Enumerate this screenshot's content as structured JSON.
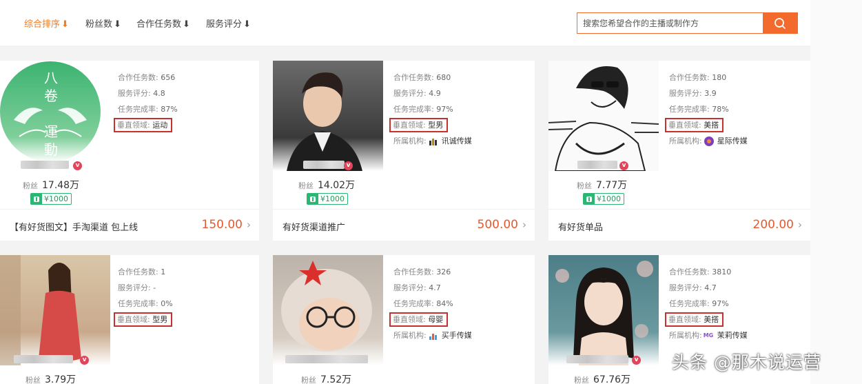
{
  "sort_bar": {
    "items": [
      {
        "label": "综合排序",
        "active": true
      },
      {
        "label": "粉丝数",
        "active": false
      },
      {
        "label": "合作任务数",
        "active": false
      },
      {
        "label": "服务评分",
        "active": false
      }
    ],
    "arrow": "⬇"
  },
  "search": {
    "placeholder": "搜索您希望合作的主播或制作方",
    "icon": "search-icon"
  },
  "labels": {
    "tasks": "合作任务数:",
    "rating": "服务评分:",
    "completion": "任务完成率:",
    "vertical": "垂直领域:",
    "agency": "所属机构:",
    "fans": "粉丝",
    "verified": "v"
  },
  "cards": [
    {
      "tasks": "656",
      "rating": "4.8",
      "completion": "87%",
      "vertical": "运动",
      "agency": "",
      "fans": "17.48万",
      "tag_price": "¥1000",
      "service_title": "【有好货图文】手淘渠道 包上线",
      "service_price": "150.00",
      "avatar_text_1": "八卷",
      "avatar_text_2": "運動"
    },
    {
      "tasks": "680",
      "rating": "4.9",
      "completion": "97%",
      "vertical": "型男",
      "agency": "讯诚传媒",
      "fans": "14.02万",
      "tag_price": "¥1000",
      "service_title": "有好货渠道推广",
      "service_price": "500.00"
    },
    {
      "tasks": "180",
      "rating": "3.9",
      "completion": "78%",
      "vertical": "美搭",
      "agency": "星际传媒",
      "fans": "7.77万",
      "tag_price": "¥1000",
      "service_title": "有好货单品",
      "service_price": "200.00"
    },
    {
      "tasks": "1",
      "rating": "-",
      "completion": "0%",
      "vertical": "型男",
      "agency": "",
      "fans": "3.79万"
    },
    {
      "tasks": "326",
      "rating": "4.7",
      "completion": "84%",
      "vertical": "母婴",
      "agency": "买手传媒",
      "fans": "7.52万"
    },
    {
      "tasks": "3810",
      "rating": "4.7",
      "completion": "97%",
      "vertical": "美搭",
      "agency": "茉莉传媒",
      "fans": "67.76万",
      "agency_logo_text": "MG"
    }
  ],
  "watermark": "头条 @那木说运营",
  "colors": {
    "accent": "#f26a2c",
    "highlight_box": "#c9302c",
    "price": "#e8582c",
    "tag_green": "#2bb673",
    "verified": "#e0455c"
  }
}
